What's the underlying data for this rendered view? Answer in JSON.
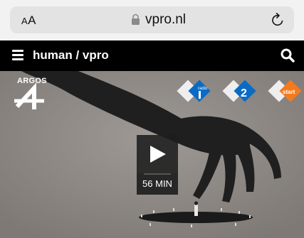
{
  "browser": {
    "text_size_label": "AA",
    "domain": "vpro.nl",
    "icons": {
      "lock": "lock-icon",
      "reload": "reload-icon"
    }
  },
  "site": {
    "title": "human / vpro",
    "icons": {
      "menu": "menu-icon",
      "search": "search-icon"
    },
    "colors": {
      "nav_bg": "#000000",
      "nav_text": "#ffffff"
    }
  },
  "video": {
    "program_logo_text": "ARGOS",
    "channels": [
      "NPO Radio 1",
      "NPO 2",
      "NPO Start"
    ],
    "duration": "56 MIN",
    "colors": {
      "npo_blue": "#0a6bc4",
      "npo_orange": "#f47a20"
    }
  }
}
